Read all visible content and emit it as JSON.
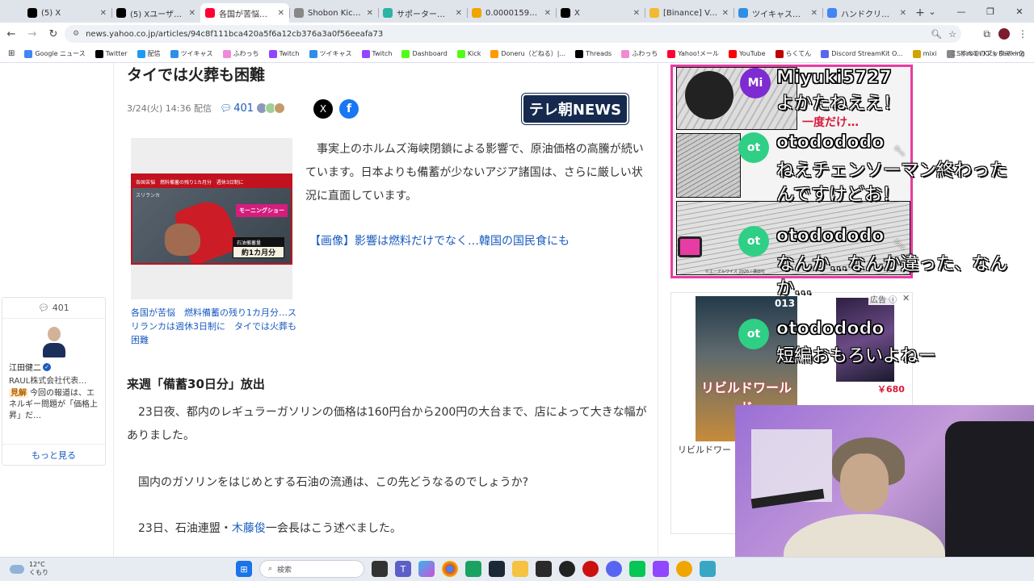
{
  "browser": {
    "tabs": [
      {
        "title": "(5) X",
        "icon": "x-icon",
        "color": "#000000",
        "active": false
      },
      {
        "title": "(5) Xユーザーの Yahoo",
        "icon": "x-icon",
        "color": "#000000",
        "active": false
      },
      {
        "title": "各国が苦悩　燃料",
        "icon": "yahoo-icon",
        "color": "#ff0033",
        "active": true
      },
      {
        "title": "Shobon Kick Rank",
        "icon": "shobon-icon",
        "color": "#888888",
        "active": false
      },
      {
        "title": "サポーター・せんちょ",
        "icon": "support-icon",
        "color": "#2bb3a3",
        "active": false
      },
      {
        "title": "0.00001595 | AXS",
        "icon": "axs-icon",
        "color": "#f0a500",
        "active": false
      },
      {
        "title": "X",
        "icon": "x-icon",
        "color": "#000000",
        "active": false
      },
      {
        "title": "[Binance] Verificat",
        "icon": "binance-icon",
        "color": "#f3ba2f",
        "active": false
      },
      {
        "title": "ツイキャス・ライブで",
        "icon": "twitcasting-icon",
        "color": "#2f8fe6",
        "active": false
      },
      {
        "title": "ハンドクリップ - Goo",
        "icon": "google-icon",
        "color": "#4285f4",
        "active": false
      }
    ],
    "url": "news.yahoo.co.jp/articles/94c8f111bca420a5f6a12cb376a3a0f56eeafa73",
    "bookmarks": [
      {
        "label": "Google ニュース",
        "color": "#4285f4"
      },
      {
        "label": "Twitter",
        "color": "#000000"
      },
      {
        "label": "配信",
        "color": "#1d9bf0"
      },
      {
        "label": "ツイキャス",
        "color": "#2f8fe6"
      },
      {
        "label": "ふわっち",
        "color": "#f08ad6"
      },
      {
        "label": "Twitch",
        "color": "#9146ff"
      },
      {
        "label": "ツイキャス",
        "color": "#2f8fe6"
      },
      {
        "label": "Twitch",
        "color": "#9146ff"
      },
      {
        "label": "Dashboard",
        "color": "#53fc18"
      },
      {
        "label": "Kick",
        "color": "#53fc18"
      },
      {
        "label": "Doneru（どねる）|...",
        "color": "#ff9a00"
      },
      {
        "label": "Threads",
        "color": "#000000"
      },
      {
        "label": "ふわっち",
        "color": "#f08ad6"
      },
      {
        "label": "Yahoo!メール",
        "color": "#ff0033"
      },
      {
        "label": "YouTube",
        "color": "#ff0000"
      },
      {
        "label": "らくてん",
        "color": "#bf0000"
      },
      {
        "label": "Discord StreamKit O...",
        "color": "#5865f2"
      },
      {
        "label": "mixi",
        "color": "#d1a200"
      },
      {
        "label": "Shobon Kick Ranking",
        "color": "#888888"
      }
    ],
    "all_bookmarks": "すべてのブックマーク"
  },
  "article": {
    "title": "タイでは火葬も困難",
    "date": "3/24(火) 14:36 配信",
    "comment_count": "401",
    "source_logo": "テレ朝NEWS",
    "image": {
      "header_left": "各国苦悩",
      "header_mid": "燃料備蓄の残り1カ月分",
      "header_right": "週休3日制に",
      "country": "スリランカ",
      "program": "モーニングショー",
      "inventory_label": "石油備蓄量",
      "inventory_value": "約1カ月分"
    },
    "caption": "各国が苦悩　燃料備蓄の残り1カ月分…スリランカは週休3日制に　タイでは火葬も困難",
    "lead": "事実上のホルムズ海峡閉鎖による影響で、原油価格の高騰が続いています。日本よりも備蓄が少ないアジア諸国は、さらに厳しい状況に直面しています。",
    "image_link": "【画像】影響は燃料だけでなく…韓国の国民食にも",
    "heading": "来週「備蓄30日分」放出",
    "para1": "23日夜、都内のレギュラーガソリンの価格は160円台から200円の大台まで、店によって大きな幅がありました。",
    "para2": "国内のガソリンをはじめとする石油の流通は、この先どうなるのでしょうか?",
    "para3_pre": "23日、石油連盟・",
    "para3_link": "木藤俊",
    "para3_post": "一会長はこう述べました。"
  },
  "comment_card": {
    "count": "401",
    "name": "江田健二",
    "org": "RAUL株式会社代表…",
    "tag": "見解",
    "text": "今回の報道は、エネルギー問題が「価格上昇」だ…",
    "more": "もっと見る"
  },
  "ads": {
    "manga_red_text": "一度だけ…",
    "manga_credit": "©エーデルワイス 2026 / 講談社",
    "cover1_number": "013",
    "cover1_title": "リビルドワールド",
    "cover1_caption": "リビルドワー",
    "cover2_price": "￥680",
    "ad_label": "広告",
    "ad_close": "✕"
  },
  "chat": [
    {
      "user": "Miyuki5727",
      "avatar": "Mi",
      "avatar_color": "#7e2bd1",
      "text": "よかたねええ！",
      "mod": false
    },
    {
      "user": "otodododo",
      "avatar": "ot",
      "avatar_color": "#2fcf86",
      "text": "ねえチェンソーマン終わったんですけどお！",
      "mod": true
    },
    {
      "user": "otodododo",
      "avatar": "ot",
      "avatar_color": "#2fcf86",
      "text": "なんか…なんか違った、なんか…",
      "mod": true
    },
    {
      "user": "otodododo",
      "avatar": "ot",
      "avatar_color": "#2fcf86",
      "text": "短編おもろいよねー",
      "mod": false
    }
  ],
  "taskbar": {
    "temp": "12°C",
    "weather": "くもり",
    "search_placeholder": "検索"
  }
}
